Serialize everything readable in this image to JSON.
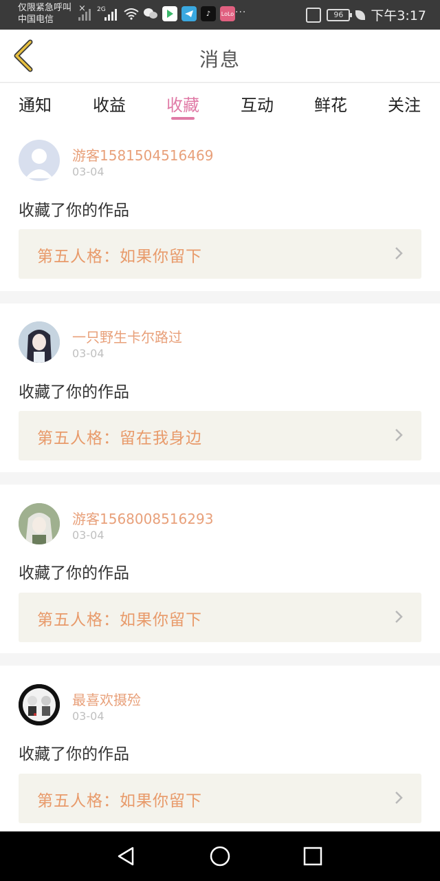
{
  "status_bar": {
    "carrier_line1": "仅限紧急呼叫",
    "carrier_line2": "中国电信",
    "network": "2G",
    "battery": "96",
    "time": "下午3:17",
    "more": "···"
  },
  "header": {
    "title": "消息",
    "back_icon": "chevron-left-icon"
  },
  "tabs": [
    {
      "label": "通知",
      "active": false
    },
    {
      "label": "收益",
      "active": false
    },
    {
      "label": "收藏",
      "active": true
    },
    {
      "label": "互动",
      "active": false
    },
    {
      "label": "鲜花",
      "active": false
    },
    {
      "label": "关注",
      "active": false
    }
  ],
  "messages": [
    {
      "username": "游客1581504516469",
      "date": "03-04",
      "action": "收藏了你的作品",
      "work_title": "第五人格：如果你留下",
      "avatar": "default-avatar"
    },
    {
      "username": "一只野生卡尔路过",
      "date": "03-04",
      "action": "收藏了你的作品",
      "work_title": "第五人格：留在我身边",
      "avatar": "anime-girl-avatar"
    },
    {
      "username": "游客1568008516293",
      "date": "03-04",
      "action": "收藏了你的作品",
      "work_title": "第五人格：如果你留下",
      "avatar": "anime-character-avatar"
    },
    {
      "username": "最喜欢摄殓",
      "date": "03-04",
      "action": "收藏了你的作品",
      "work_title": "第五人格：如果你留下",
      "avatar": "chibi-characters-avatar"
    }
  ],
  "colors": {
    "accent": "#e07aa6",
    "username": "#e8a07a",
    "work_title": "#e89a6a",
    "work_bg": "#f4f3ec",
    "back_icon": "#e8c040"
  }
}
